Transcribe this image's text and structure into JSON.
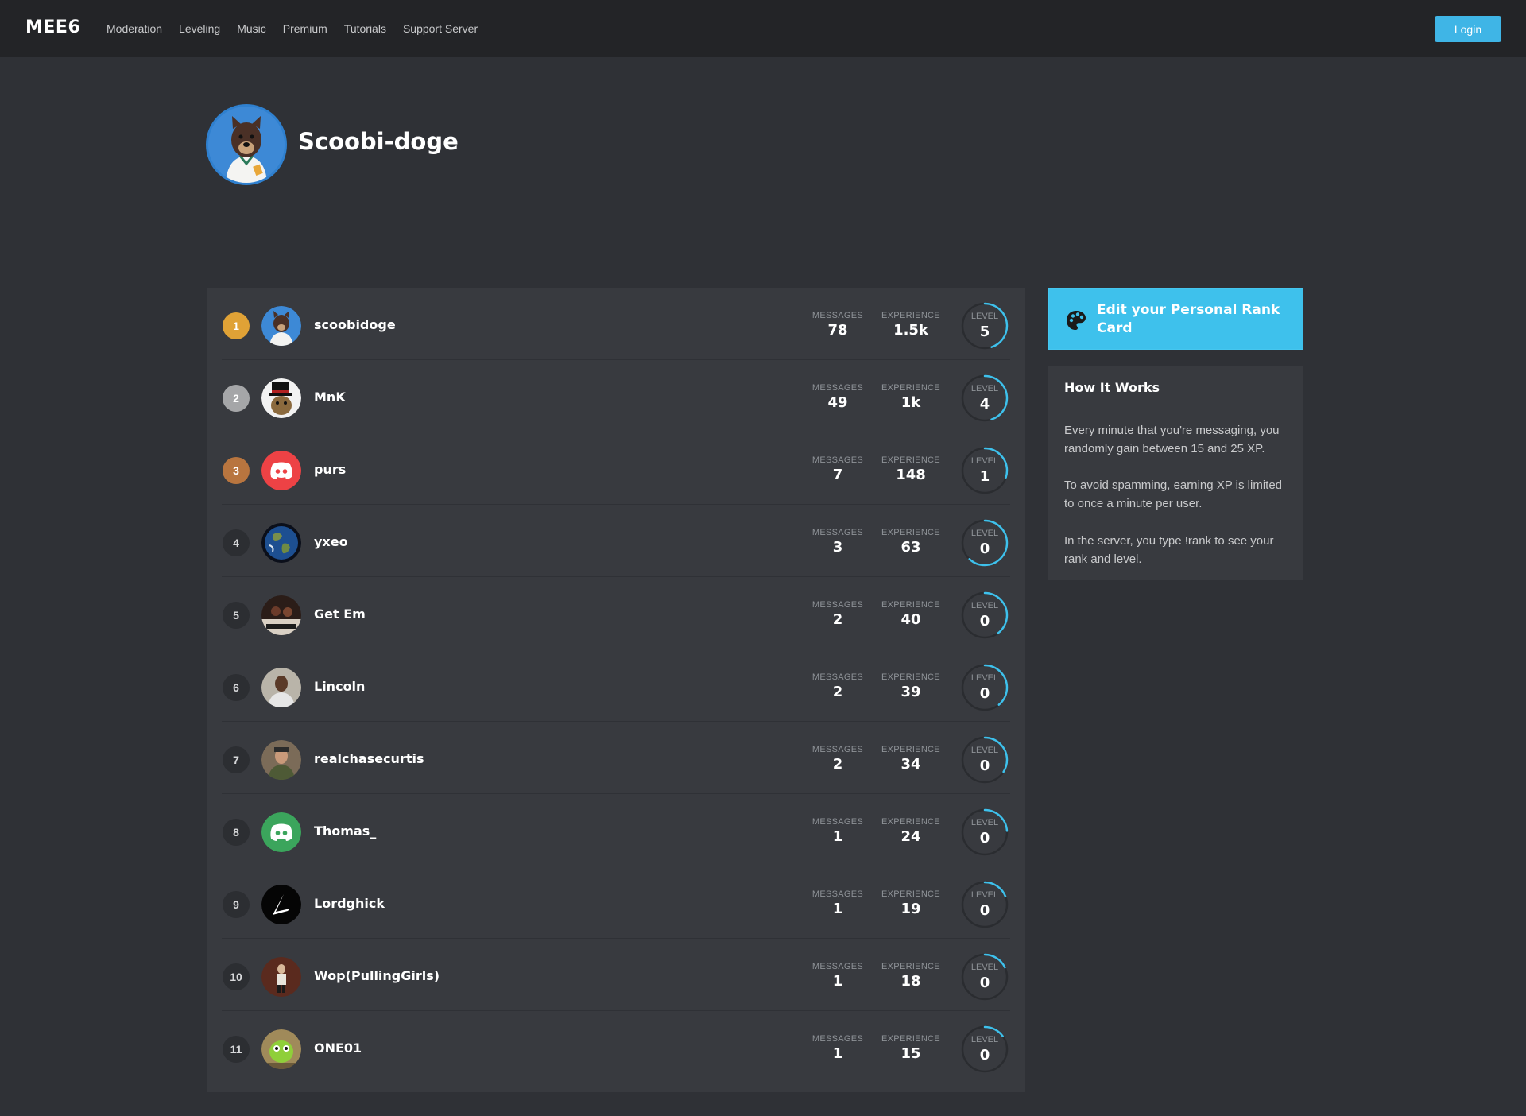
{
  "navbar": {
    "brand": "MEE6",
    "links": [
      "Moderation",
      "Leveling",
      "Music",
      "Premium",
      "Tutorials",
      "Support Server"
    ],
    "login_label": "Login"
  },
  "header": {
    "server_name": "Scoobi-doge"
  },
  "colors": {
    "accent": "#3ec1ec",
    "gold": "#e0a236",
    "silver": "#a5a6a8",
    "bronze": "#b8753f",
    "progress": "#3ec1ec"
  },
  "leaderboard": {
    "messages_label": "MESSAGES",
    "experience_label": "EXPERIENCE",
    "level_label": "LEVEL",
    "players": [
      {
        "rank": "1",
        "name": "scoobidoge",
        "messages": "78",
        "experience": "1.5k",
        "level": "5",
        "progress": 0.45,
        "avatar": "bear"
      },
      {
        "rank": "2",
        "name": "MnK",
        "messages": "49",
        "experience": "1k",
        "level": "4",
        "progress": 0.45,
        "avatar": "tophat"
      },
      {
        "rank": "3",
        "name": "purs",
        "messages": "7",
        "experience": "148",
        "level": "1",
        "progress": 0.3,
        "avatar": "discord-red"
      },
      {
        "rank": "4",
        "name": "yxeo",
        "messages": "3",
        "experience": "63",
        "level": "0",
        "progress": 0.62,
        "avatar": "earth"
      },
      {
        "rank": "5",
        "name": "Get Em",
        "messages": "2",
        "experience": "40",
        "level": "0",
        "progress": 0.4,
        "avatar": "photo-dark"
      },
      {
        "rank": "6",
        "name": "Lincoln",
        "messages": "2",
        "experience": "39",
        "level": "0",
        "progress": 0.39,
        "avatar": "photo-man"
      },
      {
        "rank": "7",
        "name": "realchasecurtis",
        "messages": "2",
        "experience": "34",
        "level": "0",
        "progress": 0.34,
        "avatar": "photo-man2"
      },
      {
        "rank": "8",
        "name": "Thomas_",
        "messages": "1",
        "experience": "24",
        "level": "0",
        "progress": 0.24,
        "avatar": "discord-green"
      },
      {
        "rank": "9",
        "name": "Lordghick",
        "messages": "1",
        "experience": "19",
        "level": "0",
        "progress": 0.19,
        "avatar": "logo-black"
      },
      {
        "rank": "10",
        "name": "Wop(PullingGirls)",
        "messages": "1",
        "experience": "18",
        "level": "0",
        "progress": 0.18,
        "avatar": "photo-kid"
      },
      {
        "rank": "11",
        "name": "ONE01",
        "messages": "1",
        "experience": "15",
        "level": "0",
        "progress": 0.15,
        "avatar": "green-creature"
      }
    ]
  },
  "sidebar": {
    "rank_card_label": "Edit your Personal Rank Card",
    "rank_card_icon": "palette-icon",
    "how_title": "How It Works",
    "paragraphs": [
      "Every minute that you're messaging, you randomly gain between 15 and 25 XP.",
      "To avoid spamming, earning XP is limited to once a minute per user.",
      "In the server, you type !rank to see your rank and level."
    ]
  }
}
